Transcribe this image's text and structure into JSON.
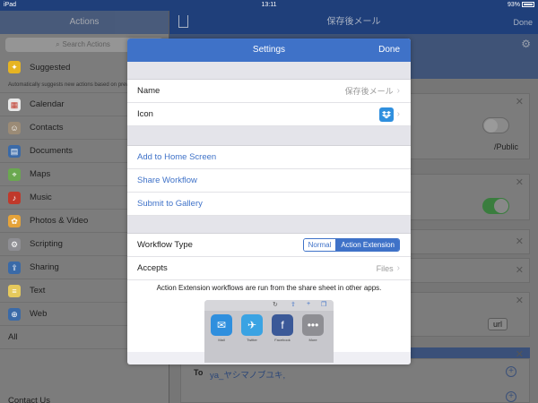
{
  "status": {
    "left": "iPad",
    "time": "13:11",
    "battery": "93%"
  },
  "sidebar": {
    "title": "Actions",
    "search_placeholder": "Search Actions",
    "suggested": {
      "label": "Suggested",
      "note": "Automatically suggests new actions based on previous actions"
    },
    "items": [
      {
        "label": "Calendar",
        "color": "#e8e8e8"
      },
      {
        "label": "Contacts",
        "color": "#9b8b76"
      },
      {
        "label": "Documents",
        "color": "#3a6aa8"
      },
      {
        "label": "Maps",
        "color": "#6aa84f"
      },
      {
        "label": "Music",
        "color": "#c0392b"
      },
      {
        "label": "Photos & Video",
        "color": "#e5a33a"
      },
      {
        "label": "Scripting",
        "color": "#8e8e93"
      },
      {
        "label": "Sharing",
        "color": "#3a6aa8"
      },
      {
        "label": "Text",
        "color": "#e6c95c"
      },
      {
        "label": "Web",
        "color": "#3a6aa8"
      },
      {
        "label": "All",
        "color": ""
      }
    ],
    "contact_us": "Contact Us"
  },
  "main": {
    "title": "保存後メール",
    "done": "Done",
    "public_path": "/Public",
    "url_label": "url",
    "to_label": "To",
    "to_value": "ya_ヤシマノブユキ,"
  },
  "modal": {
    "title": "Settings",
    "done": "Done",
    "name_label": "Name",
    "name_value": "保存後メール",
    "icon_label": "Icon",
    "links": [
      "Add to Home Screen",
      "Share Workflow",
      "Submit to Gallery"
    ],
    "workflow_type_label": "Workflow Type",
    "type_options": [
      "Normal",
      "Action Extension"
    ],
    "type_selected": "Action Extension",
    "accepts_label": "Accepts",
    "accepts_value": "Files",
    "note": "Action Extension workflows are run from the share sheet in other apps.",
    "share_apps": [
      {
        "label": "Mail",
        "color": "#2f8fde",
        "icon": "envelope-icon"
      },
      {
        "label": "Twitter",
        "color": "#3aa3e3",
        "icon": "twitter-bird-icon"
      },
      {
        "label": "Facebook",
        "color": "#3b5998",
        "icon": "facebook-f-icon"
      },
      {
        "label": "More",
        "color": "#8e8e93",
        "icon": "more-dots-icon"
      }
    ]
  }
}
